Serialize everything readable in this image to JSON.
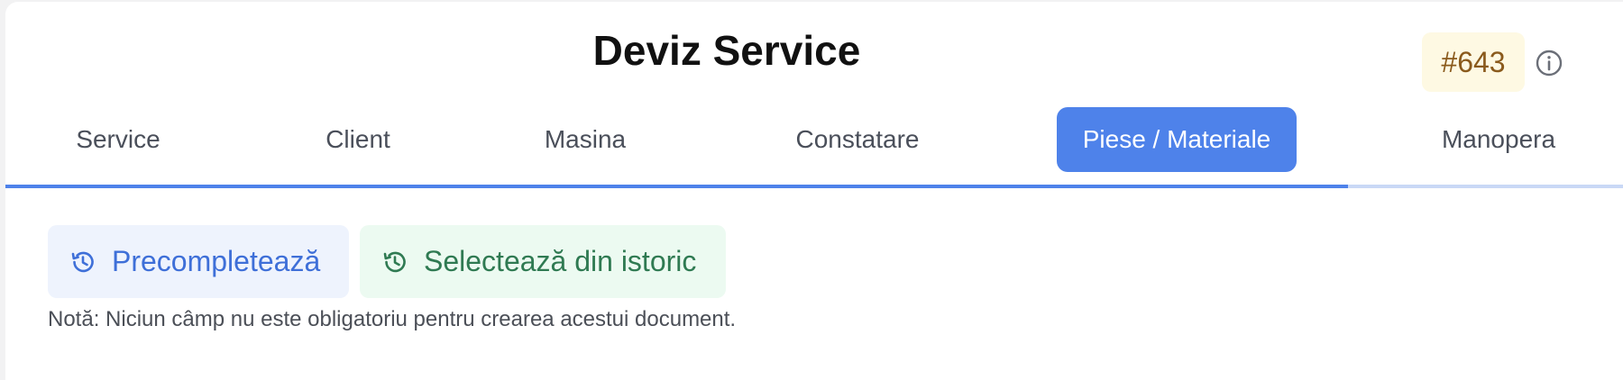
{
  "header": {
    "title": "Deviz Service",
    "doc_number": "#643",
    "info_icon": "info-circle-icon"
  },
  "tabs": [
    {
      "label": "Service",
      "active": false
    },
    {
      "label": "Client",
      "active": false
    },
    {
      "label": "Masina",
      "active": false
    },
    {
      "label": "Constatare",
      "active": false
    },
    {
      "label": "Piese / Materiale",
      "active": true
    },
    {
      "label": "Manopera",
      "active": false
    }
  ],
  "progress": {
    "fraction": 0.83
  },
  "actions": {
    "prefill_label": "Precompletează",
    "prefill_icon": "history-icon",
    "history_label": "Selectează din istoric",
    "history_icon": "history-icon"
  },
  "note": "Notă: Niciun câmp nu este obligatoriu pentru crearea acestui document.",
  "colors": {
    "accent": "#4e82ea",
    "progress_track": "#c9d8f6",
    "badge_bg": "#fef9e3",
    "badge_text": "#8a5a1c",
    "prefill_bg": "#eef3fd",
    "prefill_text": "#3e6fd8",
    "history_bg": "#ecfaf1",
    "history_text": "#2f7a52"
  }
}
